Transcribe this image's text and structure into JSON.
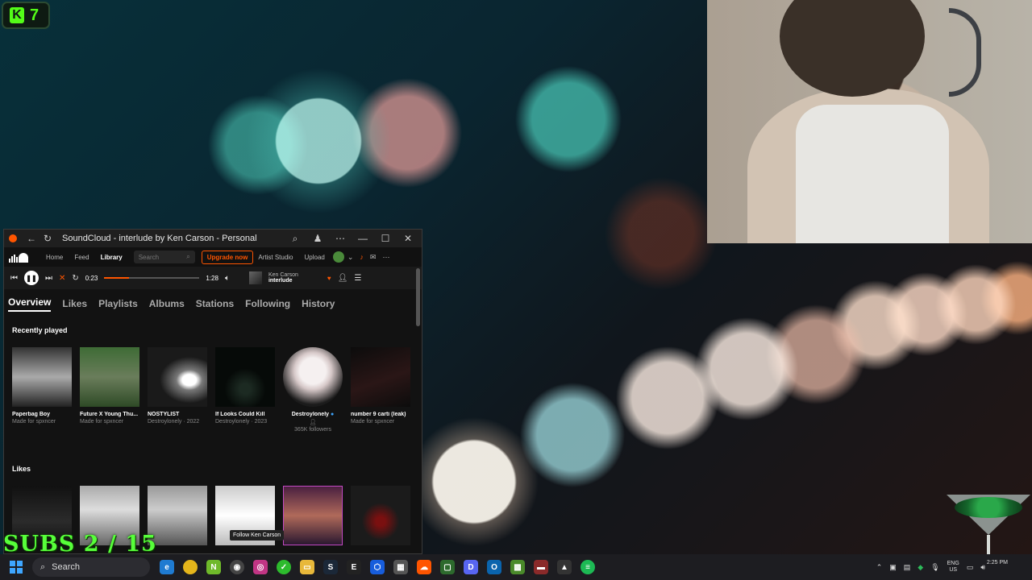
{
  "overlay": {
    "kick_count": "7",
    "subs_goal": "SUBS 2 / 15"
  },
  "window": {
    "title": "SoundCloud - interlude by Ken Carson - Personal"
  },
  "nav": {
    "home": "Home",
    "feed": "Feed",
    "library": "Library",
    "search_placeholder": "Search",
    "upgrade": "Upgrade now",
    "artist_studio": "Artist Studio",
    "upload": "Upload"
  },
  "player": {
    "elapsed": "0:23",
    "duration": "1:28",
    "progress_fraction": 0.26,
    "artist": "Ken Carson",
    "track": "interlude"
  },
  "tabs": [
    "Overview",
    "Likes",
    "Playlists",
    "Albums",
    "Stations",
    "Following",
    "History"
  ],
  "recently_played": {
    "title": "Recently played",
    "items": [
      {
        "title": "Paperbag Boy",
        "sub": "Made for spxncer"
      },
      {
        "title": "Future X Young Thu...",
        "sub": "Made for spxncer"
      },
      {
        "title": "NOSTYLIST",
        "sub": "Destroylonely · 2022"
      },
      {
        "title": "If Looks Could Kill",
        "sub": "Destroylonely · 2023"
      },
      {
        "title": "Destroylonely",
        "sub": "365K followers"
      },
      {
        "title": "number 9 carti (leak)",
        "sub": "Made for spxncer"
      }
    ]
  },
  "likes": {
    "title": "Likes",
    "tooltip": "Follow Ken Carson"
  },
  "taskbar": {
    "search": "Search",
    "lang_line1": "ENG",
    "lang_line2": "US",
    "time": "2:25 PM"
  }
}
